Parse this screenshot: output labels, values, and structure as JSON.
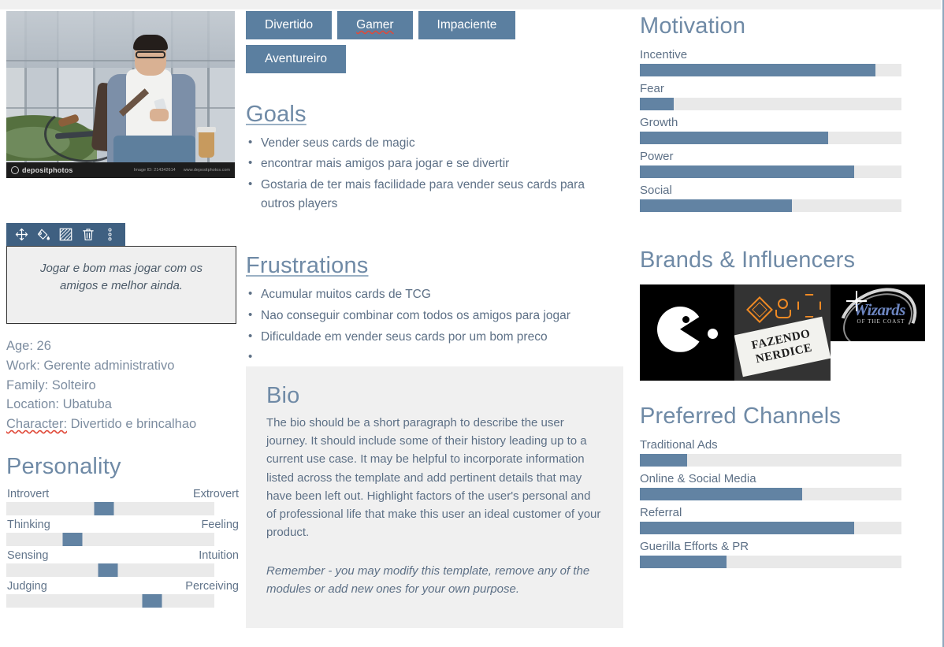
{
  "photo": {
    "watermark_brand": "depositphotos",
    "watermark_id": "Image ID: 214342614",
    "watermark_url": "www.depositphotos.com",
    "alt": "Young man with glasses holding a smartphone and coffee cup, leaning on a bicycle"
  },
  "toolbar": {
    "items": [
      {
        "name": "move-icon",
        "label": "Move"
      },
      {
        "name": "fill-color-icon",
        "label": "Fill color"
      },
      {
        "name": "transparency-icon",
        "label": "Transparency"
      },
      {
        "name": "delete-icon",
        "label": "Delete"
      },
      {
        "name": "more-options-icon",
        "label": "More options"
      }
    ]
  },
  "quote": {
    "text": "Jogar e bom mas jogar com os amigos e melhor ainda."
  },
  "facts": [
    {
      "label": "Age:",
      "value": "26",
      "misspelled_label": false
    },
    {
      "label": "Work:",
      "value": "Gerente administrativo",
      "misspelled_label": false
    },
    {
      "label": "Family:",
      "value": "Solteiro",
      "misspelled_label": false
    },
    {
      "label": "Location:",
      "value": "Ubatuba",
      "misspelled_label": false
    },
    {
      "label": "Character:",
      "value": "Divertido e brincalhao",
      "misspelled_label": true
    }
  ],
  "personality": {
    "title": "Personality",
    "sliders": [
      {
        "left": "Introvert",
        "right": "Extrovert",
        "value": 47
      },
      {
        "left": "Thinking",
        "right": "Feeling",
        "value": 32
      },
      {
        "left": "Sensing",
        "right": "Intuition",
        "value": 49
      },
      {
        "left": "Judging",
        "right": "Perceiving",
        "value": 70
      }
    ]
  },
  "tags": [
    {
      "label": "Divertido",
      "misspelled": false
    },
    {
      "label": "Gamer",
      "misspelled": true
    },
    {
      "label": "Impaciente",
      "misspelled": false
    },
    {
      "label": "Aventureiro",
      "misspelled": false
    }
  ],
  "goals": {
    "title": "Goals",
    "items": [
      "Vender seus cards de magic",
      "encontrar mais amigos para jogar e se divertir",
      "Gostaria de ter mais facilidade para vender seus cards para outros players"
    ]
  },
  "frustrations": {
    "title": "Frustrations",
    "items": [
      "Acumular muitos cards de TCG",
      "Nao conseguir combinar com todos os amigos para jogar",
      "Dificuldade em vender seus cards por um bom preco",
      ""
    ]
  },
  "bio": {
    "title": "Bio",
    "paragraph": "The bio should be a short paragraph to describe the user journey. It should include some of their history leading up to a current use case. It may be helpful to incorporate information listed across the template and add pertinent details that may have been left out. Highlight factors of the user's personal and of professional life that make this user an ideal customer of your product.",
    "note": "Remember - you may modify this template, remove any of the modules or add new ones for your own purpose."
  },
  "motivation": {
    "title": "Motivation",
    "bars": [
      {
        "label": "Incentive",
        "value": 90
      },
      {
        "label": "Fear",
        "value": 13
      },
      {
        "label": "Growth",
        "value": 72
      },
      {
        "label": "Power",
        "value": 82
      },
      {
        "label": "Social",
        "value": 58
      }
    ]
  },
  "brands": {
    "title": "Brands & Influencers",
    "logos": [
      {
        "name": "pacman-logo",
        "label": "Pac-Man"
      },
      {
        "name": "fazendo-nerdice-logo",
        "line1": "FAZENDO",
        "line2": "NERDICE"
      },
      {
        "name": "wizards-of-the-coast-logo",
        "line1": "Wizards",
        "line2": "OF THE COAST"
      }
    ]
  },
  "channels": {
    "title": "Preferred Channels",
    "bars": [
      {
        "label": "Traditional Ads",
        "value": 18
      },
      {
        "label": "Online & Social Media",
        "value": 62
      },
      {
        "label": "Referral",
        "value": 82
      },
      {
        "label": "Guerilla Efforts & PR",
        "value": 33
      }
    ]
  },
  "colors": {
    "accent_blue": "#6283a3",
    "tag_blue": "#5b7fa0",
    "toolbar_blue": "#3f6081",
    "heading_blue": "#6f8aa6",
    "body_text": "#5d7086",
    "track_gray": "#e9e9e9",
    "panel_gray": "#f0f0f0",
    "spell_red": "#e04a3a"
  },
  "chart_data": [
    {
      "type": "bar",
      "title": "Motivation",
      "categories": [
        "Incentive",
        "Fear",
        "Growth",
        "Power",
        "Social"
      ],
      "values": [
        90,
        13,
        72,
        82,
        58
      ],
      "xlabel": "",
      "ylabel": "",
      "ylim": [
        0,
        100
      ],
      "orientation": "horizontal",
      "grid": false,
      "legend": "none"
    },
    {
      "type": "bar",
      "title": "Preferred Channels",
      "categories": [
        "Traditional Ads",
        "Online & Social Media",
        "Referral",
        "Guerilla Efforts & PR"
      ],
      "values": [
        18,
        62,
        82,
        33
      ],
      "xlabel": "",
      "ylabel": "",
      "ylim": [
        0,
        100
      ],
      "orientation": "horizontal",
      "grid": false,
      "legend": "none"
    },
    {
      "type": "bar",
      "title": "Personality",
      "categories": [
        "Introvert–Extrovert",
        "Thinking–Feeling",
        "Sensing–Intuition",
        "Judging–Perceiving"
      ],
      "values": [
        47,
        32,
        49,
        70
      ],
      "xlabel": "",
      "ylabel": "",
      "ylim": [
        0,
        100
      ],
      "orientation": "horizontal",
      "grid": false,
      "legend": "none"
    }
  ]
}
